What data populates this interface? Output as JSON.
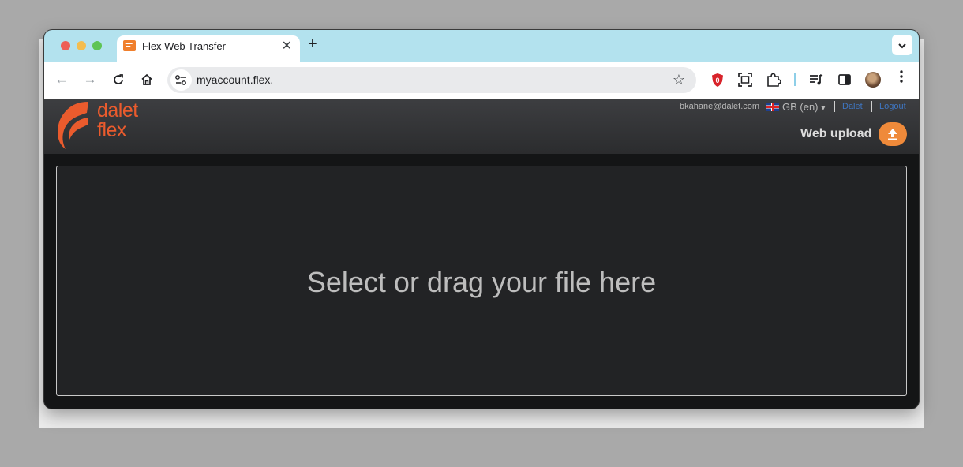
{
  "browser": {
    "tab_title": "Flex Web Transfer",
    "tab_close": "✕",
    "new_tab": "+",
    "tab_search": "⌄",
    "url": "myaccount.flex.",
    "star": "☆",
    "back": "←",
    "forward": "→",
    "reload": "↻",
    "home": "⌂",
    "menu": "⋮"
  },
  "app": {
    "logo_line1": "dalet",
    "logo_line2": "flex",
    "user_email": "bkahane@dalet.com",
    "language": "GB (en)",
    "language_caret": "▾",
    "link_dalet": "Dalet",
    "link_logout": "Logout",
    "web_upload_label": "Web upload",
    "drop_zone_text": "Select or drag your file here",
    "brand_color": "#ea5b2d",
    "upload_button_color": "#ef8a3a"
  }
}
